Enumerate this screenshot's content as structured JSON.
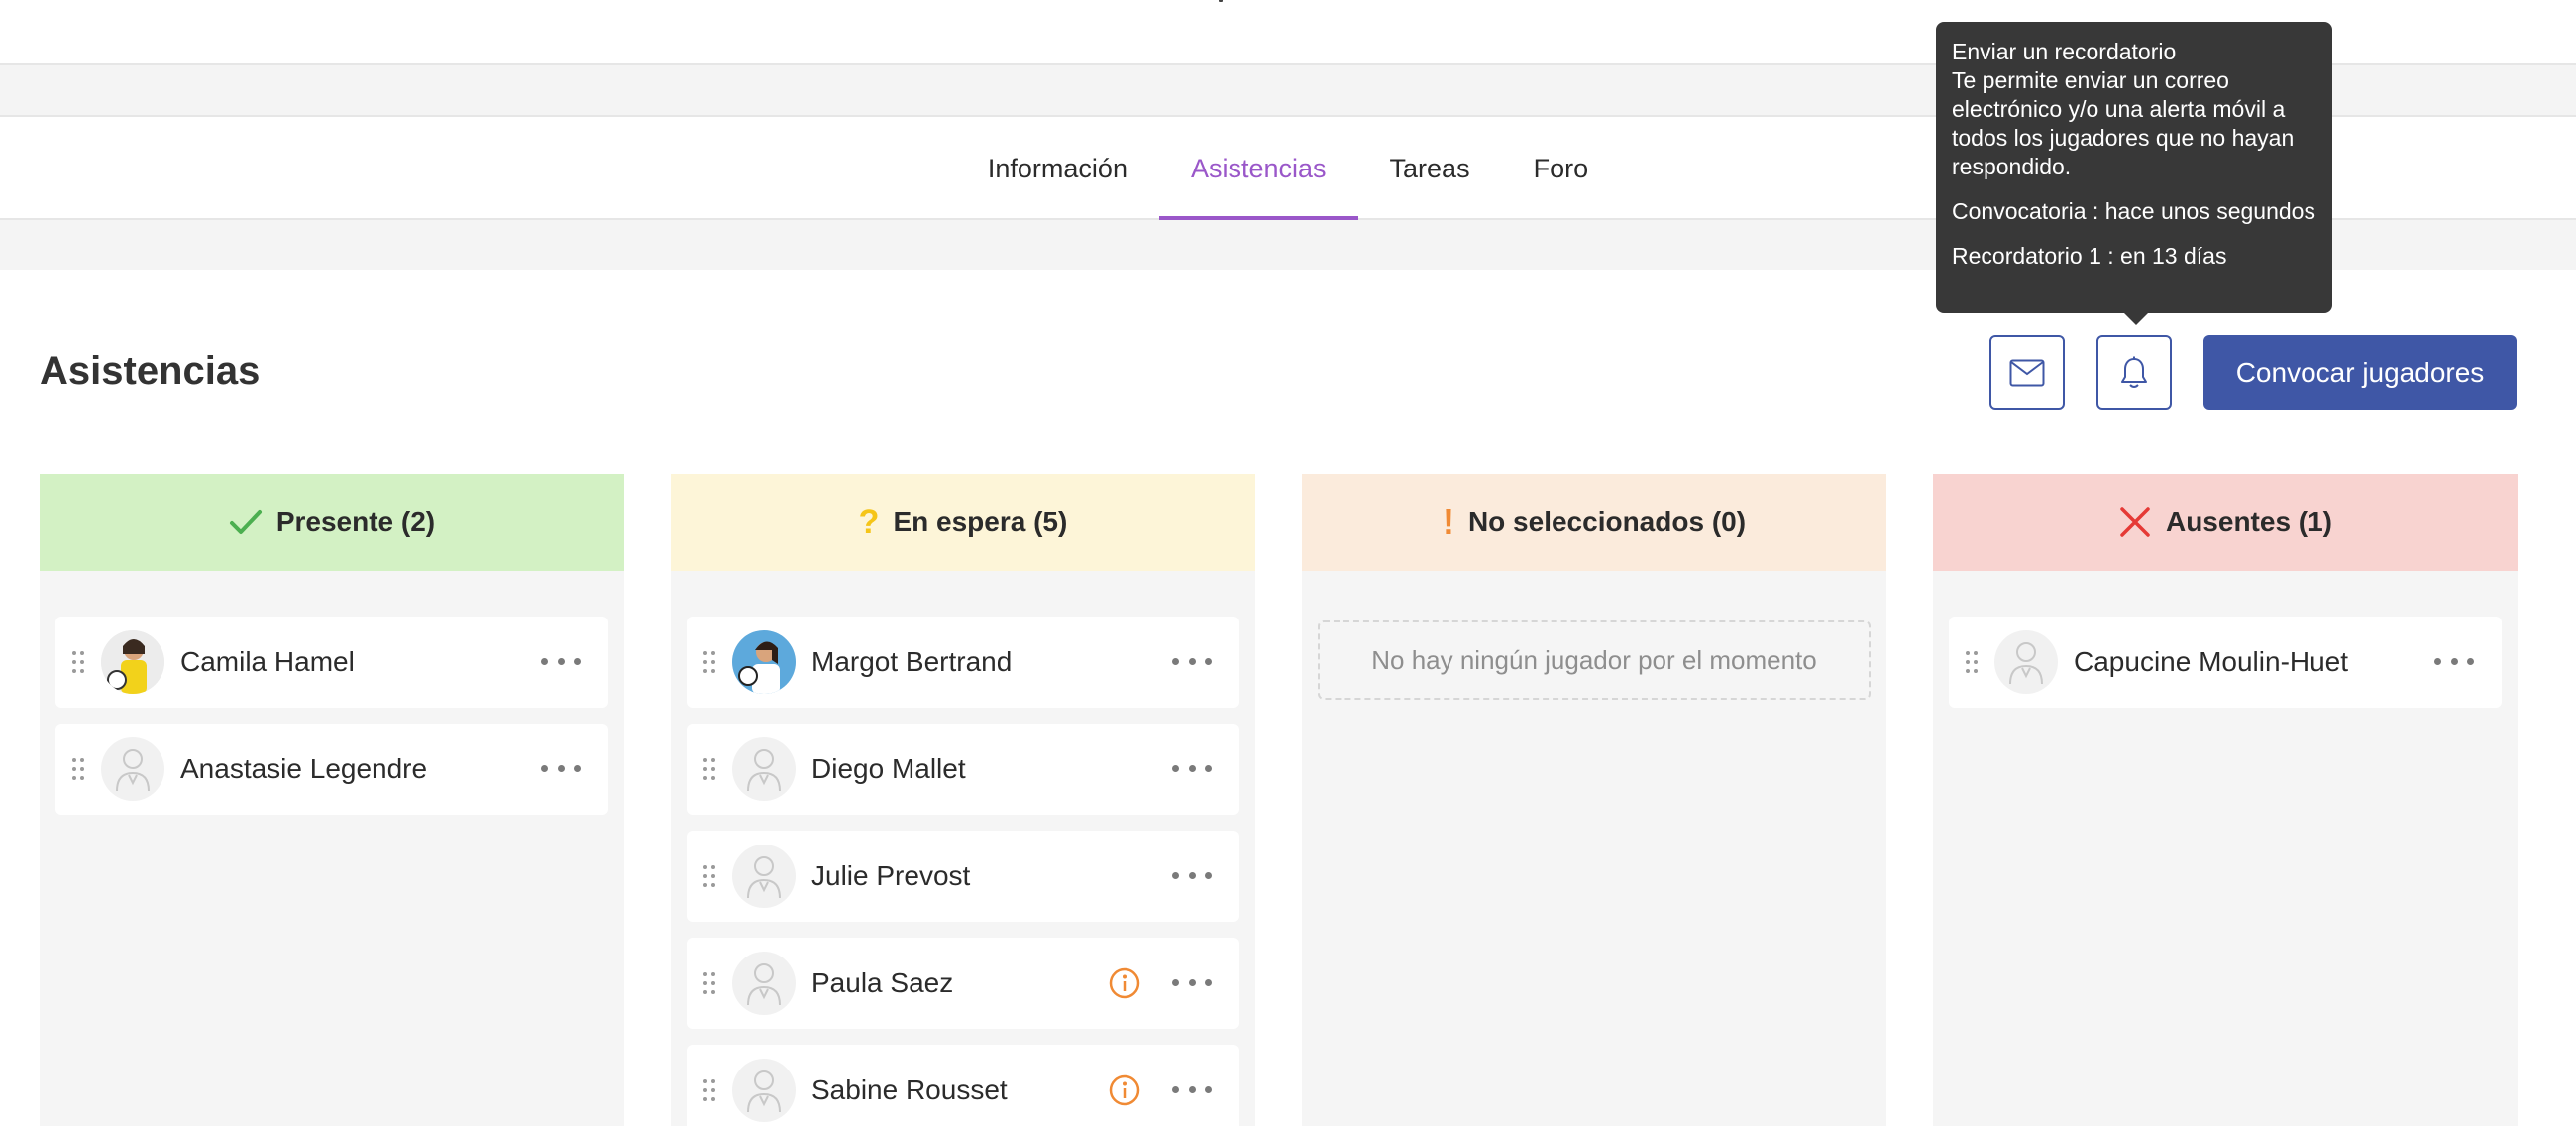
{
  "tabs": [
    {
      "label": "Información"
    },
    {
      "label": "Asistencias"
    },
    {
      "label": "Tareas"
    },
    {
      "label": "Foro"
    }
  ],
  "active_tab": "Asistencias",
  "page_title": "Asistencias",
  "actions": {
    "email_icon": "envelope-icon",
    "bell_icon": "bell-icon",
    "primary_label": "Convocar jugadores"
  },
  "tooltip": {
    "title": "Enviar un recordatorio",
    "body": "Te permite enviar un correo electrónico y/o una alerta móvil a todos los jugadores que no hayan respondido.",
    "convocatoria": "Convocatoria : hace unos segundos",
    "reminder": "Recordatorio 1 : en 13 días"
  },
  "columns": [
    {
      "title": "Presente (2)",
      "icon": "check-icon",
      "color": "#d3f1c4",
      "players": [
        {
          "name": "Camila Hamel",
          "avatar": "photo"
        },
        {
          "name": "Anastasie Legendre",
          "avatar": "placeholder"
        }
      ]
    },
    {
      "title": "En espera (5)",
      "icon": "question-icon",
      "color": "#fdf5d8",
      "players": [
        {
          "name": "Margot Bertrand",
          "avatar": "photo"
        },
        {
          "name": "Diego Mallet",
          "avatar": "placeholder"
        },
        {
          "name": "Julie Prevost",
          "avatar": "placeholder"
        },
        {
          "name": "Paula Saez",
          "avatar": "placeholder",
          "info": true
        },
        {
          "name": "Sabine Rousset",
          "avatar": "placeholder",
          "info": true
        }
      ]
    },
    {
      "title": "No seleccionados (0)",
      "icon": "exclamation-icon",
      "color": "#fbebdc",
      "empty_text": "No hay ningún jugador por el momento",
      "players": []
    },
    {
      "title": "Ausentes (1)",
      "icon": "cross-icon",
      "color": "#f8d3d0",
      "players": [
        {
          "name": "Capucine Moulin-Huet",
          "avatar": "placeholder"
        }
      ]
    }
  ],
  "colors": {
    "accent": "#9a57c9",
    "primary": "#3f57a6",
    "check": "#4caf50",
    "question": "#f5c518",
    "exclamation": "#f08a34",
    "cross": "#e53935",
    "info": "#f08a34"
  }
}
